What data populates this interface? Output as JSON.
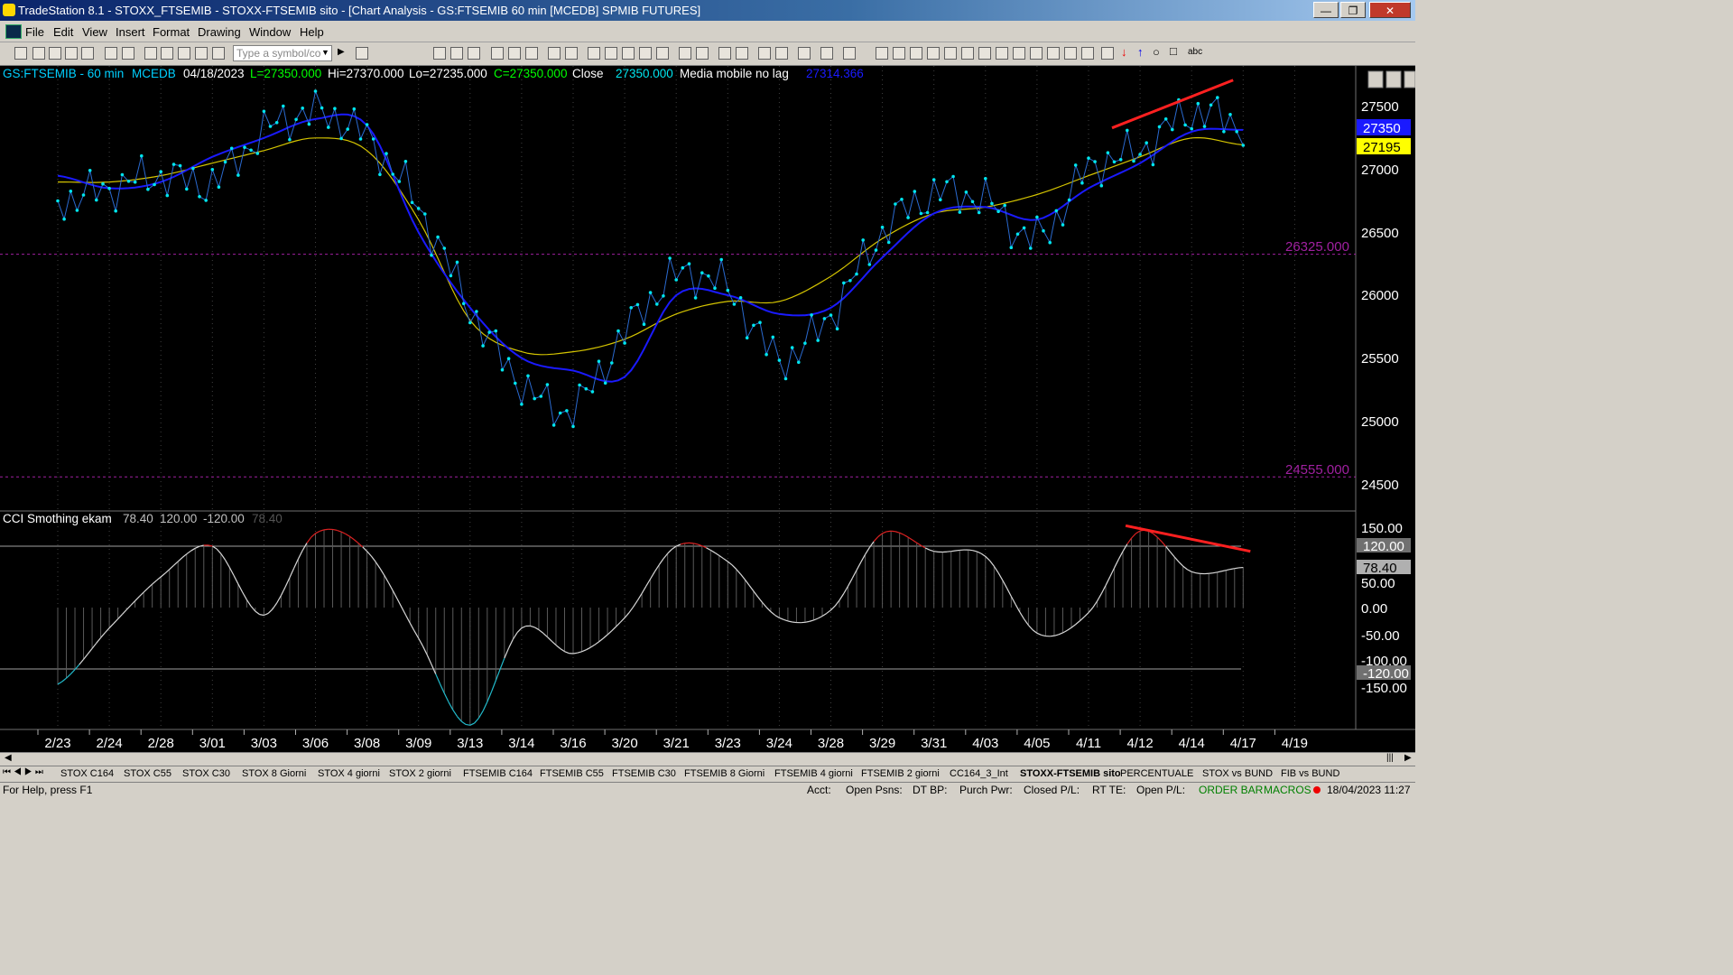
{
  "window": {
    "title": "TradeStation 8.1 - STOXX_FTSEMIB - STOXX-FTSEMIB sito - [Chart Analysis - GS:FTSEMIB  60 min  [MCEDB] SPMIB FUTURES]",
    "minimize": "—",
    "maximize": "❐",
    "close": "✕"
  },
  "menu": [
    "File",
    "Edit",
    "View",
    "Insert",
    "Format",
    "Drawing",
    "Window",
    "Help"
  ],
  "toolbar": {
    "symbol_placeholder": "Type a symbol/co",
    "abc": "abc"
  },
  "chart_header": {
    "symbol": "GS:FTSEMIB - 60 min",
    "code": "MCEDB",
    "date": "04/18/2023",
    "last": "L=27350.000",
    "high": "Hi=27370.000",
    "low": "Lo=27235.000",
    "close_eq": "C=27350.000",
    "close_label": "Close",
    "close_value": "27350.000",
    "ma_label": "Media mobile no lag",
    "ma_value": "27314.366"
  },
  "price_panel": {
    "ticks": [
      "27500",
      "27000",
      "26500",
      "26000",
      "25500",
      "25000",
      "24500"
    ],
    "price_box_blue": "27350",
    "price_box_yellow": "27195",
    "level_high": "26325.000",
    "level_low": "24555.000"
  },
  "cci_panel": {
    "label": "CCI Smothing ekam",
    "v1": "78.40",
    "v2": "120.00",
    "v3": "-120.00",
    "v4": "78.40",
    "ticks": [
      "150.00",
      "120.00",
      "78.40",
      "50.00",
      "0.00",
      "-50.00",
      "-100.00",
      "-120.00",
      "-150.00"
    ]
  },
  "colors": {
    "price_dots": "#00e5ee",
    "ma_blue": "#1a1aff",
    "ma_yellow": "#d4c400",
    "trend_red": "#ff2020",
    "level_purple": "#a020a0",
    "cci_up_red": "#dd2222",
    "cci_down_cyan": "#22bbcc"
  },
  "dates": [
    "2/23",
    "2/24",
    "2/28",
    "3/01",
    "3/03",
    "3/06",
    "3/08",
    "3/09",
    "3/13",
    "3/14",
    "3/16",
    "3/20",
    "3/21",
    "3/23",
    "3/24",
    "3/28",
    "3/29",
    "3/31",
    "4/03",
    "4/05",
    "4/11",
    "4/12",
    "4/14",
    "4/17",
    "4/19"
  ],
  "workspace_tabs": [
    "STOX C164",
    "STOX C55",
    "STOX  C30",
    "STOX  8 Giorni",
    "STOX 4 giorni",
    "STOX  2 giorni",
    "FTSEMIB C164",
    "FTSEMIB C55",
    "FTSEMIB C30",
    "FTSEMIB  8 Giorni",
    "FTSEMIB  4 giorni",
    "FTSEMIB  2 giorni",
    "CC164_3_Int",
    "STOXX-FTSEMIB sito",
    "PERCENTUALE",
    "STOX vs BUND",
    "FIB vs BUND"
  ],
  "status": {
    "help": "For Help, press F1",
    "acct": "Acct:",
    "open_psns": "Open Psns:",
    "dt_bp": "DT BP:",
    "purch_pwr": "Purch Pwr:",
    "closed_pl": "Closed P/L:",
    "rt_te": "RT TE:",
    "open_pl": "Open P/L:",
    "order_bar": "ORDER BAR",
    "macros": "MACROS",
    "datetime": "18/04/2023 11:27"
  },
  "chart_data": [
    {
      "type": "line",
      "title": "GS:FTSEMIB - 60 min",
      "x": [
        "2/23",
        "2/24",
        "2/28",
        "3/01",
        "3/03",
        "3/06",
        "3/08",
        "3/09",
        "3/13",
        "3/14",
        "3/16",
        "3/20",
        "3/21",
        "3/23",
        "3/24",
        "3/28",
        "3/29",
        "3/31",
        "4/03",
        "4/05",
        "4/11",
        "4/12",
        "4/14",
        "4/17"
      ],
      "series": [
        {
          "name": "Close",
          "values": [
            26750,
            26850,
            26950,
            26900,
            27300,
            27450,
            27250,
            26700,
            25900,
            25300,
            25100,
            25700,
            26150,
            26050,
            25500,
            25850,
            26500,
            26800,
            26750,
            26450,
            27000,
            27150,
            27450,
            27350
          ]
        },
        {
          "name": "Media mobile no lag",
          "values": [
            26950,
            26850,
            26900,
            27100,
            27250,
            27400,
            27350,
            26500,
            25900,
            25500,
            25400,
            25350,
            26000,
            26000,
            25850,
            25900,
            26300,
            26650,
            26700,
            26600,
            26850,
            27050,
            27300,
            27314
          ]
        },
        {
          "values": [
            26900,
            26900,
            26950,
            27050,
            27150,
            27250,
            27150,
            26600,
            25800,
            25550,
            25550,
            25650,
            25850,
            25950,
            25950,
            26150,
            26450,
            26650,
            26700,
            26800,
            26950,
            27100,
            27250,
            27195
          ]
        }
      ],
      "levels": [
        26325,
        24555
      ],
      "ylim": [
        24400,
        27700
      ]
    },
    {
      "type": "line",
      "title": "CCI Smothing ekam",
      "x": [
        "2/23",
        "2/24",
        "2/28",
        "3/01",
        "3/03",
        "3/06",
        "3/08",
        "3/09",
        "3/13",
        "3/14",
        "3/16",
        "3/20",
        "3/21",
        "3/23",
        "3/24",
        "3/28",
        "3/29",
        "3/31",
        "4/03",
        "4/05",
        "4/11",
        "4/12",
        "4/14",
        "4/17"
      ],
      "series": [
        {
          "name": "CCI",
          "values": [
            -150,
            -40,
            60,
            120,
            -15,
            145,
            110,
            -60,
            -230,
            -40,
            -90,
            -20,
            120,
            90,
            -20,
            -5,
            145,
            110,
            100,
            -50,
            -10,
            150,
            70,
            78.4
          ]
        }
      ],
      "levels": [
        120,
        -120
      ],
      "ylim": [
        -235,
        165
      ]
    }
  ]
}
